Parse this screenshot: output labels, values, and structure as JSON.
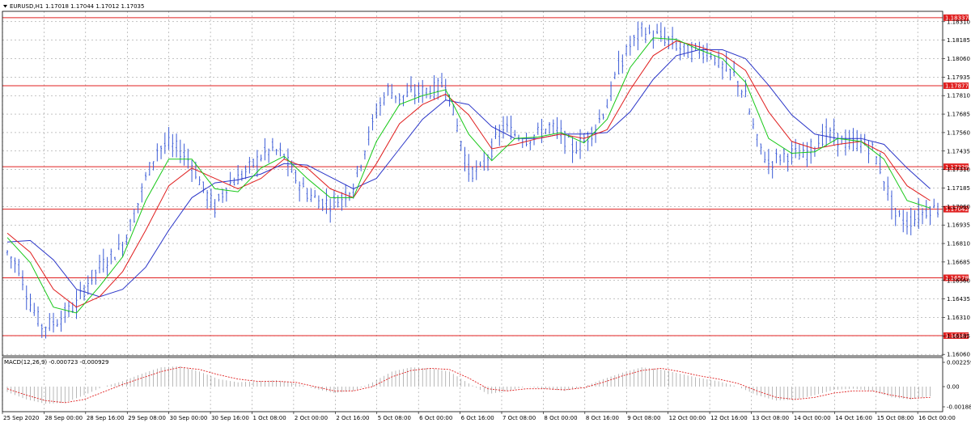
{
  "header": {
    "symbol": "EURUSD,H1",
    "ohlc": "1.17018 1.17044 1.17012 1.17035"
  },
  "macd_header": "MACD(12,26,9) -0.000723 -0.000929",
  "colors": {
    "candles": "#3b5bd6",
    "ma_fast": "#17c817",
    "ma_mid": "#e01f1f",
    "ma_slow": "#2a35c8",
    "level": "#e02020",
    "grid": "#888888",
    "macd_hist": "#9a9a9a",
    "macd_signal": "#e02020"
  },
  "chart_data": [
    {
      "type": "line",
      "title": "EURUSD,H1",
      "price_axis": {
        "range": [
          1.1605,
          1.1838
        ],
        "ticks": [
          "1.18310",
          "1.18185",
          "1.18060",
          "1.17935",
          "1.17810",
          "1.17685",
          "1.17560",
          "1.17435",
          "1.17310",
          "1.17185",
          "1.17060",
          "1.16935",
          "1.16810",
          "1.16685",
          "1.16560",
          "1.16435",
          "1.16310",
          "1.16185",
          "1.16060"
        ]
      },
      "time_labels": [
        "25 Sep 2020",
        "28 Sep 00:00",
        "28 Sep 16:00",
        "29 Sep 08:00",
        "30 Sep 00:00",
        "30 Sep 16:00",
        "1 Oct 08:00",
        "2 Oct 00:00",
        "2 Oct 16:00",
        "5 Oct 08:00",
        "6 Oct 00:00",
        "6 Oct 16:00",
        "7 Oct 08:00",
        "8 Oct 00:00",
        "8 Oct 16:00",
        "9 Oct 08:00",
        "12 Oct 00:00",
        "12 Oct 16:00",
        "13 Oct 08:00",
        "14 Oct 00:00",
        "14 Oct 16:00",
        "15 Oct 08:00",
        "16 Oct 00:00"
      ],
      "levels": [
        "1.18337",
        "1.17877",
        "1.17329",
        "1.17042",
        "1.16578",
        "1.16187"
      ],
      "price_path": [
        [
          0,
          1.1675
        ],
        [
          3,
          1.1665
        ],
        [
          6,
          1.164
        ],
        [
          9,
          1.1625
        ],
        [
          12,
          1.1627
        ],
        [
          15,
          1.1633
        ],
        [
          18,
          1.164
        ],
        [
          21,
          1.1655
        ],
        [
          24,
          1.1665
        ],
        [
          27,
          1.1672
        ],
        [
          30,
          1.168
        ],
        [
          33,
          1.17
        ],
        [
          36,
          1.1725
        ],
        [
          39,
          1.1745
        ],
        [
          42,
          1.1748
        ],
        [
          45,
          1.1744
        ],
        [
          48,
          1.1735
        ],
        [
          51,
          1.1718
        ],
        [
          54,
          1.1705
        ],
        [
          57,
          1.172
        ],
        [
          60,
          1.1725
        ],
        [
          63,
          1.1732
        ],
        [
          66,
          1.174
        ],
        [
          69,
          1.1745
        ],
        [
          72,
          1.174
        ],
        [
          75,
          1.1725
        ],
        [
          78,
          1.1715
        ],
        [
          81,
          1.171
        ],
        [
          84,
          1.1708
        ],
        [
          87,
          1.1712
        ],
        [
          90,
          1.172
        ],
        [
          93,
          1.1745
        ],
        [
          96,
          1.177
        ],
        [
          99,
          1.1785
        ],
        [
          102,
          1.178
        ],
        [
          105,
          1.1782
        ],
        [
          108,
          1.1784
        ],
        [
          111,
          1.1785
        ],
        [
          114,
          1.179
        ],
        [
          117,
          1.176
        ],
        [
          120,
          1.173
        ],
        [
          123,
          1.173
        ],
        [
          126,
          1.1745
        ],
        [
          129,
          1.176
        ],
        [
          132,
          1.1755
        ],
        [
          135,
          1.1752
        ],
        [
          138,
          1.1755
        ],
        [
          141,
          1.176
        ],
        [
          144,
          1.1755
        ],
        [
          147,
          1.1745
        ],
        [
          150,
          1.175
        ],
        [
          153,
          1.176
        ],
        [
          156,
          1.1775
        ],
        [
          159,
          1.18
        ],
        [
          162,
          1.1815
        ],
        [
          165,
          1.1825
        ],
        [
          168,
          1.1822
        ],
        [
          171,
          1.182
        ],
        [
          174,
          1.1815
        ],
        [
          177,
          1.181
        ],
        [
          180,
          1.1812
        ],
        [
          183,
          1.181
        ],
        [
          186,
          1.18
        ],
        [
          189,
          1.1795
        ],
        [
          192,
          1.178
        ],
        [
          195,
          1.175
        ],
        [
          198,
          1.1735
        ],
        [
          201,
          1.174
        ],
        [
          204,
          1.1742
        ],
        [
          207,
          1.174
        ],
        [
          210,
          1.1748
        ],
        [
          213,
          1.1755
        ],
        [
          216,
          1.1752
        ],
        [
          219,
          1.1748
        ],
        [
          222,
          1.175
        ],
        [
          225,
          1.1745
        ],
        [
          228,
          1.1725
        ],
        [
          231,
          1.17
        ],
        [
          234,
          1.1695
        ],
        [
          237,
          1.17
        ],
        [
          240,
          1.1705
        ],
        [
          242,
          1.1704
        ]
      ],
      "ma_fast": [
        [
          0,
          1.1685
        ],
        [
          6,
          1.1668
        ],
        [
          12,
          1.1638
        ],
        [
          18,
          1.1634
        ],
        [
          24,
          1.1652
        ],
        [
          30,
          1.1672
        ],
        [
          36,
          1.171
        ],
        [
          42,
          1.1738
        ],
        [
          48,
          1.1738
        ],
        [
          54,
          1.1718
        ],
        [
          60,
          1.1716
        ],
        [
          66,
          1.1732
        ],
        [
          72,
          1.174
        ],
        [
          78,
          1.1725
        ],
        [
          84,
          1.1712
        ],
        [
          90,
          1.1712
        ],
        [
          96,
          1.175
        ],
        [
          102,
          1.1775
        ],
        [
          108,
          1.1781
        ],
        [
          114,
          1.1785
        ],
        [
          120,
          1.1755
        ],
        [
          126,
          1.1737
        ],
        [
          132,
          1.1752
        ],
        [
          138,
          1.1753
        ],
        [
          144,
          1.1756
        ],
        [
          150,
          1.1749
        ],
        [
          156,
          1.1765
        ],
        [
          162,
          1.18
        ],
        [
          168,
          1.182
        ],
        [
          174,
          1.1819
        ],
        [
          180,
          1.1812
        ],
        [
          186,
          1.1806
        ],
        [
          192,
          1.179
        ],
        [
          198,
          1.1752
        ],
        [
          204,
          1.1742
        ],
        [
          210,
          1.1743
        ],
        [
          216,
          1.1752
        ],
        [
          222,
          1.175
        ],
        [
          228,
          1.1738
        ],
        [
          234,
          1.171
        ],
        [
          240,
          1.1705
        ]
      ],
      "ma_mid": [
        [
          0,
          1.1688
        ],
        [
          6,
          1.1675
        ],
        [
          12,
          1.165
        ],
        [
          18,
          1.1638
        ],
        [
          24,
          1.1645
        ],
        [
          30,
          1.1662
        ],
        [
          36,
          1.169
        ],
        [
          42,
          1.172
        ],
        [
          48,
          1.1732
        ],
        [
          54,
          1.1725
        ],
        [
          60,
          1.1718
        ],
        [
          66,
          1.1725
        ],
        [
          72,
          1.1738
        ],
        [
          78,
          1.1732
        ],
        [
          84,
          1.1718
        ],
        [
          90,
          1.1712
        ],
        [
          96,
          1.1735
        ],
        [
          102,
          1.1762
        ],
        [
          108,
          1.1775
        ],
        [
          114,
          1.1782
        ],
        [
          120,
          1.1768
        ],
        [
          126,
          1.1745
        ],
        [
          132,
          1.1748
        ],
        [
          138,
          1.1752
        ],
        [
          144,
          1.1755
        ],
        [
          150,
          1.1752
        ],
        [
          156,
          1.1758
        ],
        [
          162,
          1.1785
        ],
        [
          168,
          1.1808
        ],
        [
          174,
          1.1818
        ],
        [
          180,
          1.1814
        ],
        [
          186,
          1.1809
        ],
        [
          192,
          1.1798
        ],
        [
          198,
          1.177
        ],
        [
          204,
          1.175
        ],
        [
          210,
          1.1745
        ],
        [
          216,
          1.1748
        ],
        [
          222,
          1.175
        ],
        [
          228,
          1.1742
        ],
        [
          234,
          1.172
        ],
        [
          240,
          1.171
        ]
      ],
      "ma_slow": [
        [
          0,
          1.1682
        ],
        [
          6,
          1.1683
        ],
        [
          12,
          1.167
        ],
        [
          18,
          1.165
        ],
        [
          24,
          1.1645
        ],
        [
          30,
          1.165
        ],
        [
          36,
          1.1665
        ],
        [
          42,
          1.169
        ],
        [
          48,
          1.1712
        ],
        [
          54,
          1.1722
        ],
        [
          60,
          1.1724
        ],
        [
          66,
          1.1728
        ],
        [
          72,
          1.1735
        ],
        [
          78,
          1.1734
        ],
        [
          84,
          1.1726
        ],
        [
          90,
          1.1718
        ],
        [
          96,
          1.1725
        ],
        [
          102,
          1.1745
        ],
        [
          108,
          1.1765
        ],
        [
          114,
          1.1778
        ],
        [
          120,
          1.1775
        ],
        [
          126,
          1.176
        ],
        [
          132,
          1.1752
        ],
        [
          138,
          1.1752
        ],
        [
          144,
          1.1755
        ],
        [
          150,
          1.1755
        ],
        [
          156,
          1.1756
        ],
        [
          162,
          1.177
        ],
        [
          168,
          1.1792
        ],
        [
          174,
          1.1808
        ],
        [
          180,
          1.1812
        ],
        [
          186,
          1.1812
        ],
        [
          192,
          1.1806
        ],
        [
          198,
          1.1788
        ],
        [
          204,
          1.1768
        ],
        [
          210,
          1.1755
        ],
        [
          216,
          1.1752
        ],
        [
          222,
          1.1752
        ],
        [
          228,
          1.1748
        ],
        [
          234,
          1.1732
        ],
        [
          240,
          1.1718
        ]
      ]
    },
    {
      "type": "area",
      "title": "MACD(12,26,9) -0.000723 -0.000929",
      "ylim": [
        -0.001882,
        0.002259
      ],
      "ticks": [
        "0.002259",
        "0.00",
        "-0.001882"
      ],
      "histogram": [
        [
          0,
          -0.0005
        ],
        [
          5,
          -0.0012
        ],
        [
          10,
          -0.0016
        ],
        [
          15,
          -0.0015
        ],
        [
          20,
          -0.0008
        ],
        [
          25,
          0.0
        ],
        [
          30,
          0.0005
        ],
        [
          35,
          0.0012
        ],
        [
          40,
          0.0018
        ],
        [
          45,
          0.0019
        ],
        [
          50,
          0.0014
        ],
        [
          55,
          0.0007
        ],
        [
          60,
          0.0004
        ],
        [
          65,
          0.0005
        ],
        [
          70,
          0.0006
        ],
        [
          75,
          0.0003
        ],
        [
          80,
          -0.0002
        ],
        [
          85,
          -0.0006
        ],
        [
          90,
          -0.0004
        ],
        [
          95,
          0.0004
        ],
        [
          100,
          0.0014
        ],
        [
          105,
          0.0018
        ],
        [
          110,
          0.0017
        ],
        [
          115,
          0.0014
        ],
        [
          120,
          0.0003
        ],
        [
          125,
          -0.0007
        ],
        [
          130,
          -0.0004
        ],
        [
          135,
          0.0
        ],
        [
          140,
          -0.0002
        ],
        [
          145,
          -0.0004
        ],
        [
          150,
          0.0
        ],
        [
          155,
          0.0007
        ],
        [
          160,
          0.0013
        ],
        [
          165,
          0.0018
        ],
        [
          170,
          0.0016
        ],
        [
          175,
          0.0012
        ],
        [
          180,
          0.0008
        ],
        [
          185,
          0.0005
        ],
        [
          190,
          0.0
        ],
        [
          195,
          -0.0008
        ],
        [
          200,
          -0.0013
        ],
        [
          205,
          -0.0012
        ],
        [
          210,
          -0.0008
        ],
        [
          215,
          -0.0003
        ],
        [
          220,
          -0.0002
        ],
        [
          225,
          -0.0004
        ],
        [
          230,
          -0.001
        ],
        [
          235,
          -0.0012
        ],
        [
          240,
          -0.0009
        ]
      ],
      "signal": [
        [
          0,
          -0.0002
        ],
        [
          5,
          -0.0008
        ],
        [
          10,
          -0.0013
        ],
        [
          15,
          -0.0015
        ],
        [
          20,
          -0.0012
        ],
        [
          25,
          -0.0005
        ],
        [
          30,
          0.0002
        ],
        [
          35,
          0.0008
        ],
        [
          40,
          0.0014
        ],
        [
          45,
          0.0018
        ],
        [
          50,
          0.0016
        ],
        [
          55,
          0.0011
        ],
        [
          60,
          0.0007
        ],
        [
          65,
          0.0005
        ],
        [
          70,
          0.0005
        ],
        [
          75,
          0.0004
        ],
        [
          80,
          0.0
        ],
        [
          85,
          -0.0004
        ],
        [
          90,
          -0.0004
        ],
        [
          95,
          0.0
        ],
        [
          100,
          0.0009
        ],
        [
          105,
          0.0015
        ],
        [
          110,
          0.0017
        ],
        [
          115,
          0.0016
        ],
        [
          120,
          0.0008
        ],
        [
          125,
          -0.0002
        ],
        [
          130,
          -0.0004
        ],
        [
          135,
          -0.0002
        ],
        [
          140,
          -0.0002
        ],
        [
          145,
          -0.0003
        ],
        [
          150,
          -0.0001
        ],
        [
          155,
          0.0004
        ],
        [
          160,
          0.001
        ],
        [
          165,
          0.0015
        ],
        [
          170,
          0.0017
        ],
        [
          175,
          0.0014
        ],
        [
          180,
          0.001
        ],
        [
          185,
          0.0007
        ],
        [
          190,
          0.0003
        ],
        [
          195,
          -0.0004
        ],
        [
          200,
          -0.001
        ],
        [
          205,
          -0.0012
        ],
        [
          210,
          -0.001
        ],
        [
          215,
          -0.0006
        ],
        [
          220,
          -0.0004
        ],
        [
          225,
          -0.0004
        ],
        [
          230,
          -0.0008
        ],
        [
          235,
          -0.0011
        ],
        [
          240,
          -0.001
        ]
      ]
    }
  ]
}
